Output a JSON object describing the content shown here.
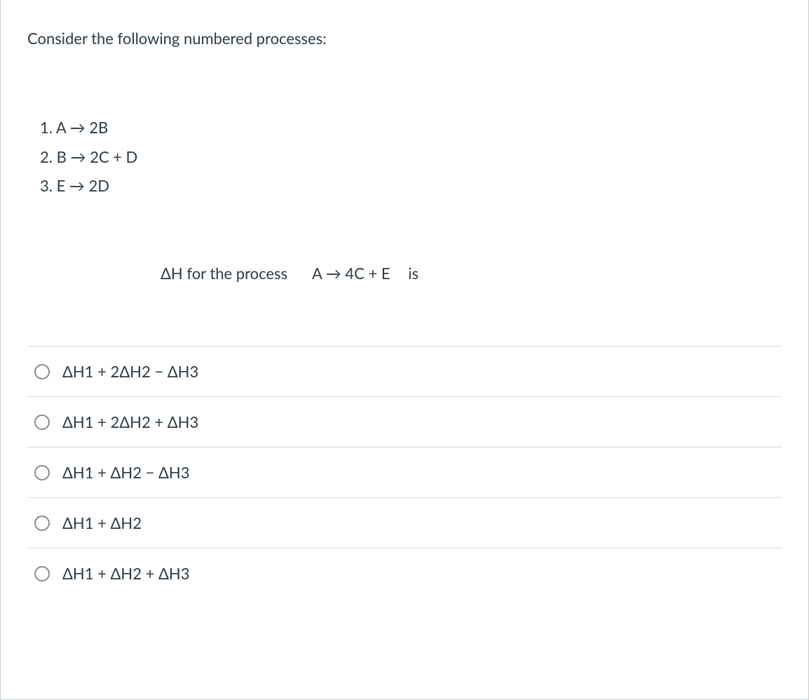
{
  "question": {
    "intro": "Consider the following numbered processes:",
    "processes": [
      "1. A → 2B",
      "2. B → 2C + D",
      "3. E → 2D"
    ],
    "delta_h": {
      "label": "ΔH for the process",
      "process": "A → 4C + E",
      "suffix": "is"
    }
  },
  "options": [
    "ΔH1 + 2ΔH2 − ΔH3",
    "ΔH1 + 2ΔH2 + ΔH3",
    "ΔH1 + ΔH2 − ΔH3",
    "ΔH1 + ΔH2",
    "ΔH1 + ΔH2 + ΔH3"
  ]
}
